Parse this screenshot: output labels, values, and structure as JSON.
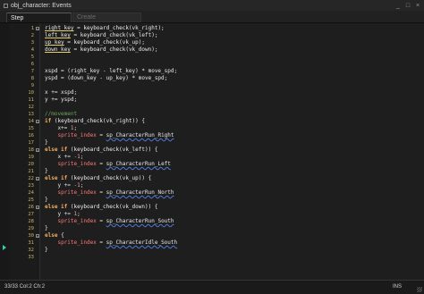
{
  "window": {
    "title": "obj_character: Events",
    "controls": [
      "_",
      "□",
      "×"
    ]
  },
  "tabs": [
    {
      "label": "Step",
      "active": true
    },
    {
      "label": "Create",
      "active": false
    }
  ],
  "status": {
    "position": "33/33 Col:2 Ch:2",
    "mode": "INS"
  },
  "lines": [
    {
      "n": "1",
      "text": "right_key = keyboard_check(vk_right);"
    },
    {
      "n": "2",
      "text": "left_key = keyboard_check(vk_left);"
    },
    {
      "n": "3",
      "text": "up_key = keyboard_check(vk_up);"
    },
    {
      "n": "4",
      "text": "down_key = keyboard_check(vk_down);"
    },
    {
      "n": "5",
      "text": ""
    },
    {
      "n": "6",
      "text": ""
    },
    {
      "n": "7",
      "text": "xspd = (right_key - left_key) * move_spd;"
    },
    {
      "n": "8",
      "text": "yspd = (down_key - up_key) * move_spd;"
    },
    {
      "n": "9",
      "text": ""
    },
    {
      "n": "10",
      "text": "x += xspd;"
    },
    {
      "n": "11",
      "text": "y += yspd;"
    },
    {
      "n": "12",
      "text": ""
    },
    {
      "n": "13",
      "text": "//movement"
    },
    {
      "n": "14",
      "text": "if (keyboard_check(vk_right)) {"
    },
    {
      "n": "15",
      "text": "    x+= 1;"
    },
    {
      "n": "16",
      "text": "    sprite_index = sp_CharacterRun_Right"
    },
    {
      "n": "17",
      "text": "}"
    },
    {
      "n": "18",
      "text": "else if (keyboard_check(vk_left)) {"
    },
    {
      "n": "19",
      "text": "    x += -1;"
    },
    {
      "n": "20",
      "text": "    sprite_index = sp_CharacterRun_Left"
    },
    {
      "n": "21",
      "text": "}"
    },
    {
      "n": "22",
      "text": "else if (keyboard_check(vk_up)) {"
    },
    {
      "n": "23",
      "text": "    y += -1;"
    },
    {
      "n": "24",
      "text": "    sprite_index = sp_CharacterRun_North"
    },
    {
      "n": "25",
      "text": "}"
    },
    {
      "n": "26",
      "text": "else if (keyboard_check(vk_down)) {"
    },
    {
      "n": "27",
      "text": "    y += 1;"
    },
    {
      "n": "28",
      "text": "    sprite_index = sp_CharacterRun_South"
    },
    {
      "n": "29",
      "text": "}"
    },
    {
      "n": "30",
      "text": "else {"
    },
    {
      "n": "31",
      "text": "    sprite_index = sp_CharacterIdle_South"
    },
    {
      "n": "32",
      "text": "}"
    },
    {
      "n": "33",
      "text": ""
    }
  ]
}
